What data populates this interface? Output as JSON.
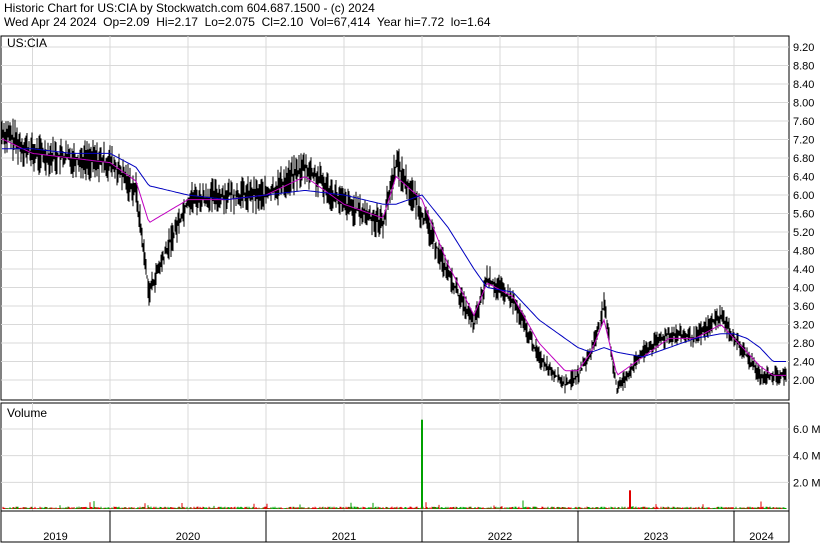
{
  "header": {
    "title": "Historic Chart for US:CIA by Stockwatch.com 604.687.1500 - (c) 2024",
    "quote": "Wed Apr 24 2024  Op=2.09  Hi=2.17  Lo=2.075  Cl=2.10  Vol=67,414  Year hi=7.72  lo=1.64"
  },
  "chart_data": [
    {
      "type": "line",
      "title": "US:CIA",
      "ylim": [
        1.64,
        9.4
      ],
      "yticks": [
        "2.00",
        "2.40",
        "2.80",
        "3.20",
        "3.60",
        "4.00",
        "4.40",
        "4.80",
        "5.20",
        "5.60",
        "6.00",
        "6.40",
        "6.80",
        "7.20",
        "7.60",
        "8.00",
        "8.40",
        "8.80",
        "9.20"
      ],
      "grid": true,
      "x": [
        "2019-01",
        "2019-04",
        "2019-07",
        "2019-10",
        "2020-01",
        "2020-03",
        "2020-04",
        "2020-07",
        "2020-10",
        "2021-01",
        "2021-04",
        "2021-07",
        "2021-10",
        "2021-11",
        "2022-01",
        "2022-03",
        "2022-05",
        "2022-06",
        "2022-08",
        "2022-10",
        "2022-12",
        "2023-01",
        "2023-02",
        "2023-03",
        "2023-04",
        "2023-06",
        "2023-08",
        "2023-10",
        "2023-12",
        "2024-01",
        "2024-02",
        "2024-03",
        "2024-04"
      ],
      "series": [
        {
          "role": "price",
          "values": [
            6.9,
            7.5,
            6.9,
            6.8,
            6.7,
            6.1,
            3.9,
            5.9,
            6.0,
            6.0,
            6.6,
            5.8,
            5.4,
            6.7,
            5.6,
            4.3,
            3.2,
            4.2,
            3.7,
            2.5,
            1.9,
            2.1,
            2.6,
            3.6,
            1.8,
            2.6,
            3.0,
            2.9,
            3.4,
            2.9,
            2.5,
            2.1,
            2.1
          ]
        },
        {
          "role": "short-moving-average",
          "values": [
            6.9,
            7.3,
            6.9,
            6.8,
            6.7,
            6.3,
            5.4,
            5.9,
            5.9,
            6.0,
            6.4,
            5.8,
            5.5,
            6.4,
            5.9,
            4.5,
            3.4,
            4.1,
            3.8,
            2.8,
            2.2,
            2.2,
            2.6,
            3.3,
            2.1,
            2.5,
            2.9,
            2.9,
            3.2,
            2.9,
            2.6,
            2.3,
            2.1
          ]
        },
        {
          "role": "long-moving-average",
          "values": [
            6.9,
            7.0,
            7.0,
            6.9,
            6.9,
            6.6,
            6.2,
            6.0,
            5.9,
            6.0,
            6.1,
            6.0,
            5.8,
            5.8,
            6.0,
            5.3,
            4.4,
            4.0,
            3.9,
            3.3,
            2.9,
            2.7,
            2.6,
            2.7,
            2.6,
            2.5,
            2.7,
            2.9,
            3.0,
            3.0,
            2.9,
            2.7,
            2.4
          ]
        }
      ],
      "colors": {
        "price": "#000000",
        "short_ma": "#c000c0",
        "long_ma": "#0000c0",
        "grid": "#d9d9d9",
        "frame": "#000000"
      }
    },
    {
      "type": "bar",
      "title": "Volume",
      "ylim": [
        0,
        7.2
      ],
      "yunits": "millions",
      "yticks": [
        "2.0 M",
        "4.0 M",
        "6.0 M"
      ],
      "grid": true,
      "spikes": [
        {
          "date": "2022-01",
          "value": 6.7,
          "color": "#00a000"
        },
        {
          "date": "2023-05",
          "value": 1.4,
          "color": "#e00000"
        }
      ],
      "baseline_volume": 0.15,
      "colors": {
        "up": "#00a000",
        "down": "#e00000"
      }
    }
  ],
  "xaxis": {
    "years": [
      "2019",
      "2020",
      "2021",
      "2022",
      "2023",
      "2024"
    ]
  }
}
